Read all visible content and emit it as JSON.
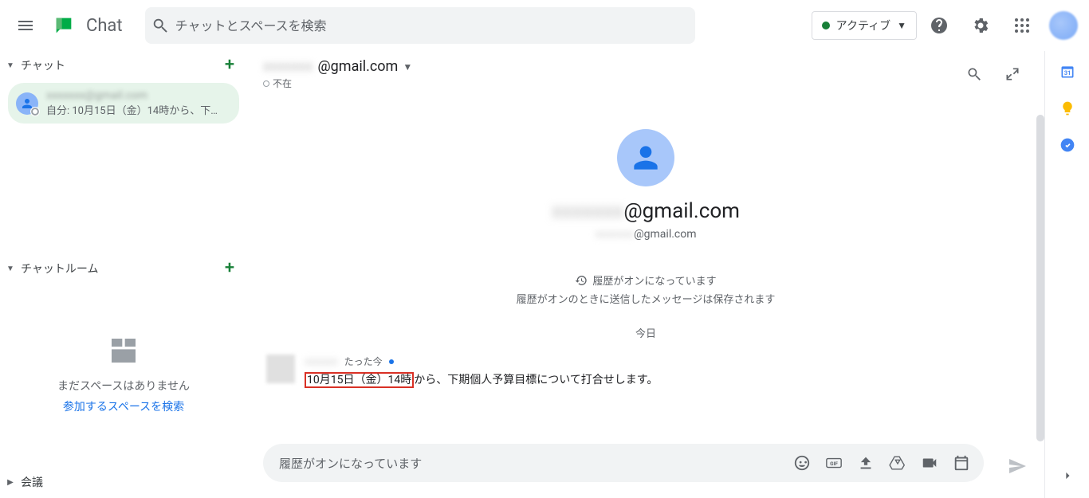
{
  "header": {
    "app_title": "Chat",
    "search_placeholder": "チャットとスペースを検索",
    "status_label": "アクティブ"
  },
  "sidebar": {
    "chats_label": "チャット",
    "rooms_label": "チャットルーム",
    "meetings_label": "会議",
    "chat_item": {
      "name_suffix": "@gmail.com",
      "preview": "自分: 10月15日（金）14時から、下…"
    },
    "rooms_empty": {
      "l1": "まだスペースはありません",
      "l2": "参加するスペースを検索"
    }
  },
  "conversation": {
    "title_suffix": "@gmail.com",
    "presence": "不在",
    "big_name_suffix": "@gmail.com",
    "big_email_suffix": "@gmail.com",
    "history_on": "履歴がオンになっています",
    "history_desc": "履歴がオンのときに送信したメッセージは保存されます",
    "date": "今日"
  },
  "message": {
    "time": "たった今",
    "highlight": "10月15日（金）14時",
    "rest": "から、下期個人予算目標について打合せします。"
  },
  "composer": {
    "placeholder": "履歴がオンになっています"
  }
}
